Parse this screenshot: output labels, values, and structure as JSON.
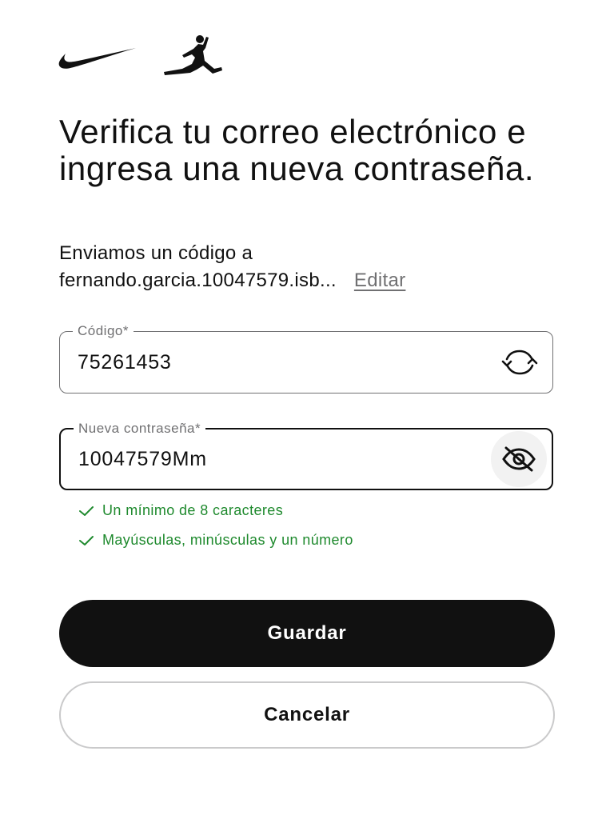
{
  "header": {
    "logos": [
      "nike-swoosh-logo",
      "jordan-jumpman-logo"
    ]
  },
  "page": {
    "title": "Verifica tu correo electrónico e ingresa una nueva contraseña.",
    "sent_text": "Enviamos un código a",
    "email": "fernando.garcia.10047579.isb...",
    "edit_label": "Editar"
  },
  "code_field": {
    "label": "Código*",
    "value": "75261453",
    "icon": "resend-refresh-icon"
  },
  "password_field": {
    "label": "Nueva contraseña*",
    "value": "10047579Mm",
    "icon": "eye-slash-icon"
  },
  "requirements": [
    "Un mínimo de 8 caracteres",
    "Mayúsculas, minúsculas y un número"
  ],
  "buttons": {
    "save": "Guardar",
    "cancel": "Cancelar"
  },
  "colors": {
    "primary": "#111111",
    "success": "#1f8a2e",
    "muted": "#707072"
  }
}
